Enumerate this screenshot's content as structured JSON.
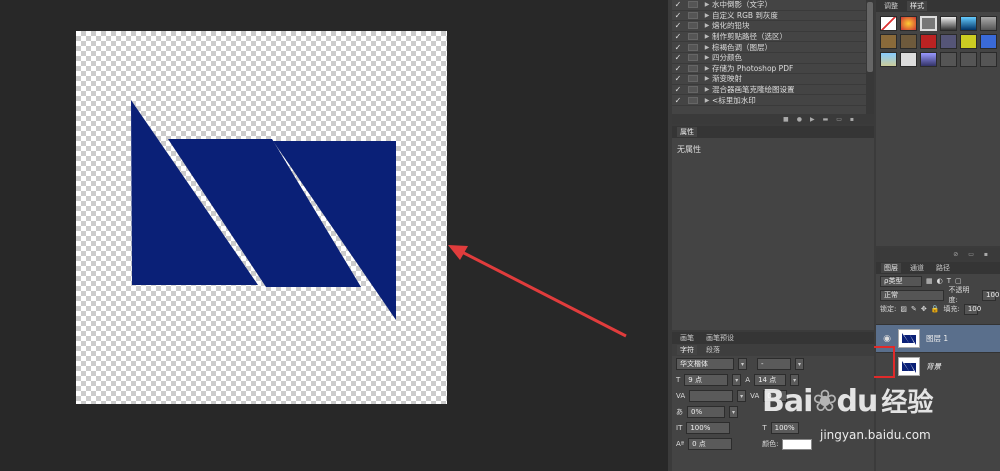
{
  "actions": {
    "items": [
      "水中倒影（文字）",
      "自定义 RGB 到灰度",
      "熔化的铅块",
      "制作剪贴路径（选区）",
      "棕褐色调（图层）",
      "四分颜色",
      "存储为 Photoshop PDF",
      "渐变映射",
      "混合器画笔克隆绘图设置",
      "<标里加水印"
    ]
  },
  "properties": {
    "tab": "属性",
    "empty_text": "无属性"
  },
  "styles": {
    "tabs": [
      "调整",
      "样式"
    ]
  },
  "layers": {
    "tabs": [
      "图层",
      "通道",
      "路径"
    ],
    "filter_label": "ρ类型",
    "blend_mode": "正常",
    "opacity_label": "不透明度:",
    "opacity_value": "100",
    "lock_label": "锁定:",
    "fill_label": "填充:",
    "fill_value": "100",
    "items": [
      {
        "name": "图层 1"
      },
      {
        "name": "背景"
      }
    ]
  },
  "character": {
    "panel_tabs": [
      "画笔",
      "画笔预设"
    ],
    "sub_tabs": [
      "字符",
      "段落"
    ],
    "font_family": "华文楷体",
    "font_style": "-",
    "font_size": "9 点",
    "leading": "14 点",
    "kerning": "",
    "tracking": "0",
    "scale_pct": "0%",
    "vscale": "100%",
    "hscale": "100%",
    "baseline": "0 点",
    "color_label": "颜色:"
  },
  "watermark": {
    "brand": "Bai",
    "brand2": "du",
    "cn": "经验",
    "url": "jingyan.baidu.com"
  },
  "colors": {
    "shape": "#0a2077",
    "arrow": "#e03c3c",
    "highlight": "#e02a2a"
  }
}
